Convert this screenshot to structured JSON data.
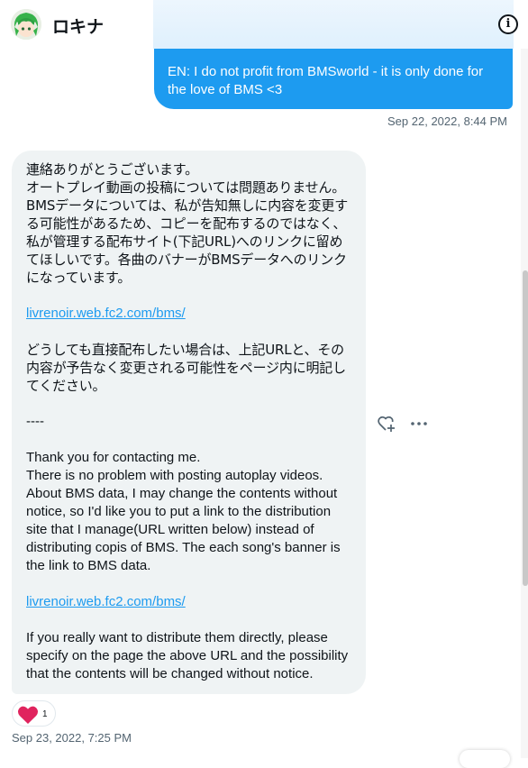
{
  "header": {
    "name": "ロキナ",
    "info_icon": "info-icon",
    "info_glyph": "i"
  },
  "sent_message": {
    "text": "EN: I do not profit from BMSworld - it is only done for the love of BMS <3",
    "timestamp": "Sep 22, 2022, 8:44 PM",
    "color": "#1d9bf0"
  },
  "received_message": {
    "ja_para1": "連絡ありがとうございます。\nオートプレイ動画の投稿については問題ありません。\nBMSデータについては、私が告知無しに内容を変更する可能性があるため、コピーを配布するのではなく、私が管理する配布サイト(下記URL)へのリンクに留めてほしいです。各曲のバナーがBMSデータへのリンクになっています。",
    "link1": "livrenoir.web.fc2.com/bms/",
    "ja_para2": "どうしても直接配布したい場合は、上記URLと、その内容が予告なく変更される可能性をページ内に明記してください。",
    "separator": "----",
    "en_para1": "Thank you for contacting me.\nThere is no problem with posting autoplay videos.\nAbout BMS data, I may change the contents without notice, so I'd like you to put a link to the distribution site that I manage(URL written below) instead of distributing copis of BMS. The each song's banner is the link to BMS data.",
    "link2": "livrenoir.web.fc2.com/bms/",
    "en_para2": "If you really want to distribute them directly, please specify on the page the above URL and the possibility that the contents will be changed without notice.",
    "timestamp": "Sep 23, 2022, 7:25 PM"
  },
  "actions": {
    "react_icon": "add-reaction-icon",
    "more_icon": "more-icon"
  },
  "reaction": {
    "icon": "heart-icon",
    "count": "1",
    "color": "#e0245e"
  }
}
